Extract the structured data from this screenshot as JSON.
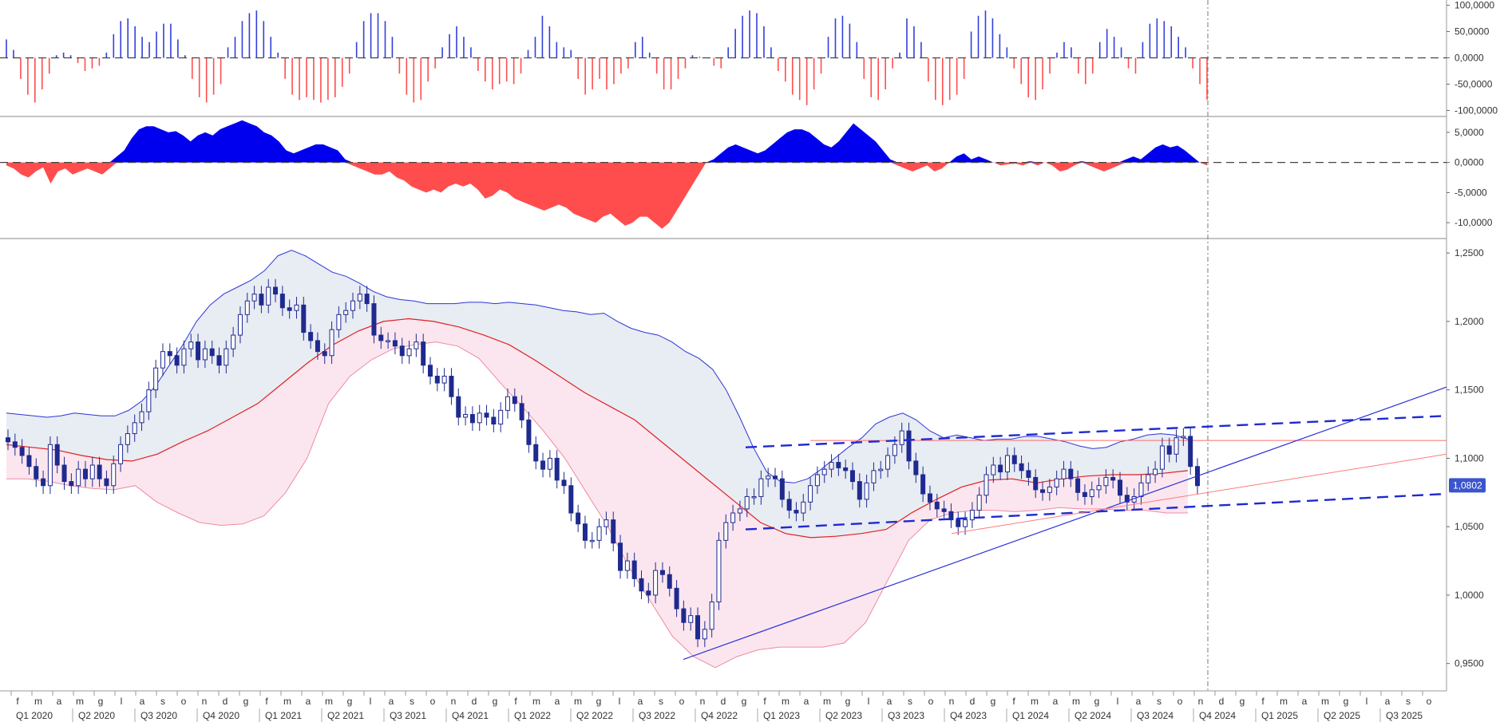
{
  "price_tag": "1,0802",
  "colors": {
    "bull": "#3340d8",
    "bear": "#ff4d4d",
    "candle": "#1f2a8f",
    "band_upper": "#2b35d6",
    "band_fill_upper": "#e8ecf3",
    "band_fill_lower": "#fbe6ef",
    "band_lower": "#f08aa0",
    "ma": "#e02020",
    "trend": "#2a30d8",
    "channel": "#1f2ad0",
    "tag_bg": "#3b55cc"
  },
  "chart_data": [
    {
      "panel": "top-oscillator",
      "type": "bar",
      "ylim": [
        -110000,
        110000
      ],
      "yticks": [
        "100,0000",
        "50,0000",
        "0,0000",
        "-50,0000",
        "-100,0000"
      ],
      "ytick_values": [
        100000,
        50000,
        0,
        -50000,
        -100000
      ],
      "zero_line": "dashed",
      "series": [
        {
          "key": "histogram",
          "values_weekly_approx": [
            35000,
            15000,
            -40000,
            -70000,
            -85000,
            -60000,
            -30000,
            5000,
            10000,
            5000,
            -10000,
            -25000,
            -20000,
            -15000,
            10000,
            45000,
            70000,
            75000,
            60000,
            40000,
            30000,
            50000,
            65000,
            65000,
            35000,
            5000,
            -40000,
            -75000,
            -85000,
            -70000,
            -50000,
            20000,
            40000,
            70000,
            85000,
            90000,
            70000,
            40000,
            10000,
            -40000,
            -70000,
            -80000,
            -75000,
            -80000,
            -85000,
            -80000,
            -75000,
            -55000,
            -30000,
            30000,
            70000,
            85000,
            85000,
            70000,
            40000,
            -30000,
            -70000,
            -85000,
            -80000,
            -45000,
            -20000,
            20000,
            45000,
            60000,
            40000,
            20000,
            -25000,
            -45000,
            -60000,
            -50000,
            -45000,
            -50000,
            -30000,
            15000,
            40000,
            80000,
            60000,
            30000,
            20000,
            15000,
            -40000,
            -70000,
            -60000,
            -40000,
            -60000,
            -50000,
            -30000,
            -20000,
            30000,
            40000,
            10000,
            -30000,
            -60000,
            -60000,
            -40000,
            -20000,
            5000,
            2000,
            0,
            -15000,
            -20000,
            20000,
            55000,
            80000,
            90000,
            85000,
            60000,
            20000,
            -25000,
            -45000,
            -70000,
            -80000,
            -90000,
            -60000,
            -30000,
            40000,
            75000,
            80000,
            65000,
            30000,
            -40000,
            -75000,
            -80000,
            -60000,
            -20000,
            10000,
            75000,
            60000,
            30000,
            -45000,
            -80000,
            -90000,
            -80000,
            -70000,
            -40000,
            50000,
            80000,
            90000,
            75000,
            45000,
            20000,
            -20000,
            -50000,
            -75000,
            -80000,
            -60000,
            -30000,
            10000,
            30000,
            20000,
            -30000,
            -50000,
            -30000,
            30000,
            55000,
            40000,
            20000,
            -20000,
            -30000,
            30000,
            65000,
            75000,
            70000,
            60000,
            40000,
            20000,
            -20000,
            -50000,
            -80000
          ]
        }
      ]
    },
    {
      "panel": "middle-oscillator",
      "type": "area",
      "ylim": [
        -12500,
        7500
      ],
      "yticks": [
        "5,0000",
        "0,0000",
        "-5,0000",
        "-10,0000"
      ],
      "ytick_values": [
        5000,
        0,
        -5000,
        -10000
      ],
      "zero_line": "dashed",
      "series": [
        {
          "key": "oscillator",
          "values_weekly_approx": [
            -500,
            -1000,
            -2000,
            -2500,
            -1500,
            -800,
            -3500,
            -1500,
            -1000,
            -2000,
            -1500,
            -1000,
            -1500,
            -2000,
            -1000,
            1000,
            2000,
            4000,
            5500,
            6000,
            6000,
            5500,
            5000,
            5200,
            4500,
            3500,
            4500,
            5000,
            4500,
            5500,
            6000,
            6500,
            7000,
            6500,
            6000,
            5000,
            4500,
            3500,
            2000,
            1500,
            2000,
            2500,
            3000,
            3000,
            2500,
            2000,
            500,
            -500,
            -1000,
            -1500,
            -2000,
            -2000,
            -1500,
            -2500,
            -3000,
            -4000,
            -4500,
            -5000,
            -4500,
            -5000,
            -4000,
            -3500,
            -4000,
            -3500,
            -4500,
            -6000,
            -5500,
            -4500,
            -5000,
            -6000,
            -6500,
            -7000,
            -7500,
            -8000,
            -7500,
            -7000,
            -7500,
            -8500,
            -9000,
            -9500,
            -10000,
            -9000,
            -8500,
            -9500,
            -10500,
            -10000,
            -9000,
            -9000,
            -10000,
            -11000,
            -10000,
            -8000,
            -6000,
            -4000,
            -2000,
            0,
            500,
            1500,
            2500,
            3000,
            2500,
            2000,
            1500,
            2000,
            3000,
            4000,
            5000,
            5500,
            5500,
            5000,
            4000,
            3000,
            2500,
            3500,
            5000,
            6500,
            5500,
            4500,
            3500,
            2000,
            500,
            -500,
            -1000,
            -1500,
            -1000,
            -500,
            -1500,
            -1000,
            0,
            1000,
            1500,
            500,
            1000,
            500,
            0,
            -500,
            -300,
            -200,
            -500,
            200,
            -500,
            0,
            -500,
            -1500,
            -1200,
            -500,
            200,
            -500,
            -1000,
            -1500,
            -1000,
            -500,
            500,
            1000,
            500,
            1500,
            2500,
            3000,
            2500,
            2800,
            2000,
            1000,
            0,
            -500
          ]
        }
      ]
    },
    {
      "panel": "price",
      "type": "candlestick",
      "ylim": [
        0.93,
        1.26
      ],
      "yticks": [
        "1,2500",
        "1,2000",
        "1,1500",
        "1,1000",
        "1,0500",
        "1,0000",
        "0,9500"
      ],
      "ytick_values": [
        1.25,
        1.2,
        1.15,
        1.1,
        1.05,
        1.0,
        0.95
      ],
      "last_price": 1.0802,
      "close_weekly_approx": [
        1.112,
        1.108,
        1.102,
        1.094,
        1.085,
        1.08,
        1.11,
        1.095,
        1.083,
        1.08,
        1.092,
        1.085,
        1.095,
        1.085,
        1.08,
        1.096,
        1.11,
        1.118,
        1.126,
        1.134,
        1.15,
        1.166,
        1.178,
        1.175,
        1.168,
        1.18,
        1.185,
        1.172,
        1.18,
        1.175,
        1.168,
        1.18,
        1.19,
        1.205,
        1.215,
        1.22,
        1.212,
        1.225,
        1.22,
        1.21,
        1.208,
        1.212,
        1.192,
        1.186,
        1.178,
        1.175,
        1.194,
        1.205,
        1.208,
        1.215,
        1.22,
        1.213,
        1.19,
        1.186,
        1.186,
        1.182,
        1.175,
        1.18,
        1.185,
        1.168,
        1.16,
        1.155,
        1.16,
        1.145,
        1.13,
        1.132,
        1.126,
        1.133,
        1.13,
        1.125,
        1.135,
        1.145,
        1.14,
        1.128,
        1.11,
        1.098,
        1.092,
        1.1,
        1.084,
        1.08,
        1.06,
        1.052,
        1.04,
        1.04,
        1.05,
        1.055,
        1.038,
        1.018,
        1.025,
        1.012,
        1.003,
        1.0,
        1.018,
        1.015,
        1.005,
        0.99,
        0.98,
        0.985,
        0.968,
        0.975,
        0.995,
        1.04,
        1.053,
        1.06,
        1.063,
        1.072,
        1.072,
        1.085,
        1.087,
        1.085,
        1.07,
        1.062,
        1.06,
        1.068,
        1.08,
        1.088,
        1.092,
        1.097,
        1.093,
        1.091,
        1.083,
        1.07,
        1.082,
        1.091,
        1.092,
        1.102,
        1.11,
        1.12,
        1.098,
        1.088,
        1.074,
        1.068,
        1.063,
        1.061,
        1.055,
        1.05,
        1.055,
        1.062,
        1.073,
        1.088,
        1.095,
        1.09,
        1.102,
        1.096,
        1.091,
        1.086,
        1.077,
        1.075,
        1.079,
        1.085,
        1.092,
        1.085,
        1.075,
        1.072,
        1.077,
        1.08,
        1.086,
        1.084,
        1.073,
        1.068,
        1.072,
        1.082,
        1.088,
        1.092,
        1.109,
        1.103,
        1.115,
        1.116,
        1.094,
        1.08
      ],
      "bands": {
        "upper_approx": [
          1.133,
          1.132,
          1.131,
          1.13,
          1.131,
          1.133,
          1.132,
          1.131,
          1.131,
          1.135,
          1.142,
          1.153,
          1.168,
          1.183,
          1.2,
          1.212,
          1.22,
          1.225,
          1.23,
          1.237,
          1.248,
          1.252,
          1.248,
          1.242,
          1.236,
          1.233,
          1.228,
          1.222,
          1.218,
          1.216,
          1.215,
          1.213,
          1.213,
          1.213,
          1.214,
          1.214,
          1.213,
          1.214,
          1.213,
          1.212,
          1.21,
          1.208,
          1.207,
          1.205,
          1.206,
          1.2,
          1.195,
          1.192,
          1.19,
          1.185,
          1.178,
          1.173,
          1.165,
          1.15,
          1.13,
          1.108,
          1.09,
          1.083,
          1.082,
          1.085,
          1.092,
          1.1,
          1.108,
          1.115,
          1.125,
          1.13,
          1.133,
          1.128,
          1.12,
          1.115,
          1.117,
          1.115,
          1.113,
          1.114,
          1.114,
          1.116,
          1.116,
          1.114,
          1.112,
          1.109,
          1.107,
          1.108,
          1.112,
          1.114,
          1.117,
          1.118,
          1.117,
          1.114
        ],
        "middle_approx": [
          1.11,
          1.108,
          1.106,
          1.102,
          1.099,
          1.098,
          1.103,
          1.112,
          1.12,
          1.13,
          1.14,
          1.155,
          1.17,
          1.183,
          1.193,
          1.2,
          1.202,
          1.2,
          1.196,
          1.19,
          1.183,
          1.172,
          1.16,
          1.148,
          1.138,
          1.128,
          1.113,
          1.098,
          1.083,
          1.068,
          1.053,
          1.045,
          1.042,
          1.043,
          1.045,
          1.048,
          1.06,
          1.07,
          1.079,
          1.084,
          1.085,
          1.082,
          1.085,
          1.087,
          1.088,
          1.088,
          1.089,
          1.091
        ],
        "lower_approx": [
          1.085,
          1.085,
          1.083,
          1.08,
          1.078,
          1.077,
          1.08,
          1.068,
          1.06,
          1.053,
          1.051,
          1.052,
          1.058,
          1.075,
          1.1,
          1.14,
          1.16,
          1.172,
          1.18,
          1.183,
          1.185,
          1.182,
          1.173,
          1.155,
          1.138,
          1.12,
          1.1,
          1.075,
          1.05,
          1.02,
          0.995,
          0.97,
          0.955,
          0.947,
          0.955,
          0.96,
          0.962,
          0.962,
          0.962,
          0.965,
          0.98,
          1.01,
          1.04,
          1.055,
          1.06,
          1.062,
          1.062,
          1.061,
          1.062,
          1.064,
          1.063,
          1.063,
          1.062,
          1.062,
          1.06,
          1.06
        ]
      },
      "horizontal_line": 1.113,
      "lines": [
        {
          "key": "trend",
          "from": [
            "Oct 2022",
            0.953
          ],
          "to": [
            "end",
            1.152
          ]
        },
        {
          "key": "channel-upper",
          "style": "dashed",
          "from": [
            "Jan 2023",
            1.108
          ],
          "to": [
            "end",
            1.131
          ]
        },
        {
          "key": "channel-lower",
          "style": "dashed",
          "from": [
            "Jan 2023",
            1.048
          ],
          "to": [
            "end",
            1.074
          ]
        },
        {
          "key": "thin-red",
          "from": [
            "Nov 2023",
            1.045
          ],
          "to": [
            "end",
            1.103
          ]
        }
      ]
    }
  ],
  "xaxis": {
    "months": [
      "f",
      "m",
      "a",
      "m",
      "g",
      "l",
      "a",
      "s",
      "o",
      "n",
      "d",
      "g",
      "f",
      "m",
      "a",
      "m",
      "g",
      "l",
      "a",
      "s",
      "o",
      "n",
      "d",
      "g",
      "f",
      "m",
      "a",
      "m",
      "g",
      "l",
      "a",
      "s",
      "o",
      "n",
      "d",
      "g",
      "f",
      "m",
      "a",
      "m",
      "g",
      "l",
      "a",
      "s",
      "o",
      "n",
      "d",
      "g",
      "f",
      "m",
      "a",
      "m",
      "g",
      "l",
      "a",
      "s",
      "o",
      "n",
      "d",
      "g",
      "f",
      "m",
      "a",
      "m",
      "g",
      "l",
      "a",
      "s",
      "o"
    ],
    "quarters": [
      "Q1 2020",
      "Q2 2020",
      "Q3 2020",
      "Q4 2020",
      "Q1 2021",
      "Q2 2021",
      "Q3 2021",
      "Q4 2021",
      "Q1 2022",
      "Q2 2022",
      "Q3 2022",
      "Q4 2022",
      "Q1 2023",
      "Q2 2023",
      "Q3 2023",
      "Q4 2023",
      "Q1 2024",
      "Q2 2024",
      "Q3 2024",
      "Q4 2024",
      "Q1 2025",
      "Q2 2025",
      "Q3 2025"
    ]
  }
}
